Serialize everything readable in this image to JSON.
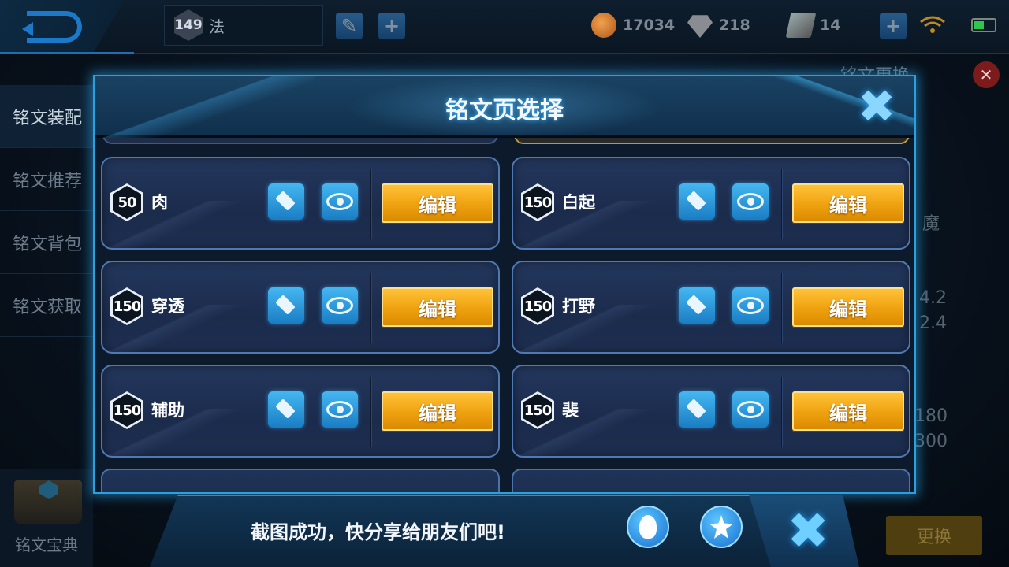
{
  "topbar": {
    "level": "149",
    "level_name": "法",
    "gold": "17034",
    "diamonds": "218",
    "vouchers": "14"
  },
  "side_menu": {
    "items": [
      {
        "label": "铭文装配"
      },
      {
        "label": "铭文推荐"
      },
      {
        "label": "铭文背包"
      },
      {
        "label": "铭文获取"
      }
    ],
    "codex": "铭文宝典"
  },
  "background": {
    "right_title": "铭文更换",
    "peek_1": "魔",
    "peek_2": "4.2",
    "peek_3": "2.4",
    "peek_4": "180",
    "peek_5": "300",
    "replace_button": "更换"
  },
  "modal": {
    "title": "铭文页选择",
    "pages": [
      {
        "level": "50",
        "name": "肉",
        "edit_label": "编辑"
      },
      {
        "level": "150",
        "name": "白起",
        "edit_label": "编辑"
      },
      {
        "level": "150",
        "name": "穿透",
        "edit_label": "编辑"
      },
      {
        "level": "150",
        "name": "打野",
        "edit_label": "编辑"
      },
      {
        "level": "150",
        "name": "辅助",
        "edit_label": "编辑"
      },
      {
        "level": "150",
        "name": "裴",
        "edit_label": "编辑"
      }
    ]
  },
  "share": {
    "text": "截图成功，快分享给朋友们吧!"
  }
}
